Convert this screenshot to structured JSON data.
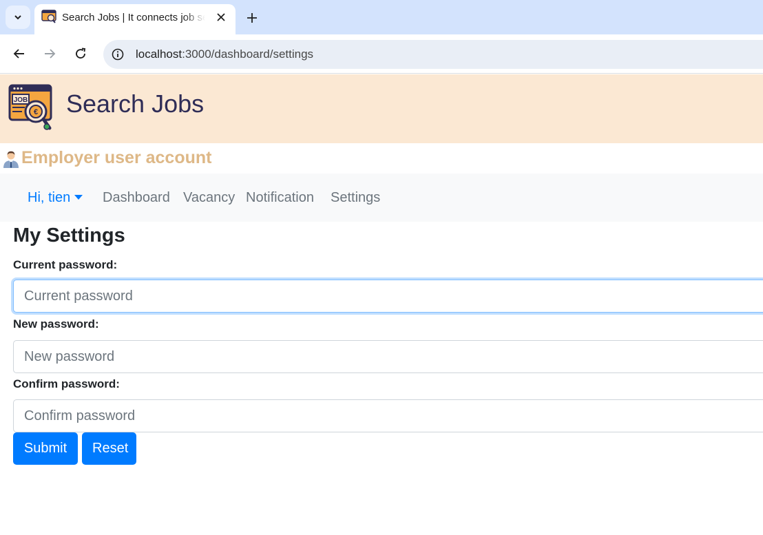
{
  "browser": {
    "tab_title": "Search Jobs | It connects job seekers and employers",
    "url_host": "localhost",
    "url_rest": ":3000/dashboard/settings",
    "icons": {
      "tab_search": "chevron-down-icon",
      "tab_close": "close-icon",
      "new_tab": "plus-icon",
      "back": "back-arrow-icon",
      "forward": "forward-arrow-icon",
      "reload": "reload-icon",
      "site_info": "info-icon"
    }
  },
  "header": {
    "brand": "Search Jobs",
    "logo": "job-search-logo-icon"
  },
  "account": {
    "label": "Employer user account",
    "icon": "businessman-icon",
    "color": "#deb887"
  },
  "navbar": {
    "user": "Hi, tien",
    "links": [
      "Dashboard",
      "Vacancy",
      "Notification",
      "Settings"
    ]
  },
  "form": {
    "title": "My Settings",
    "current_label": "Current password:",
    "current_placeholder": "Current password",
    "new_label": "New password:",
    "new_placeholder": "New password",
    "confirm_label": "Confirm password:",
    "confirm_placeholder": "Confirm password",
    "submit": "Submit",
    "reset": "Reset"
  },
  "colors": {
    "banner": "#fbe8d3",
    "primary": "#007bff",
    "brand_text": "#2f2d57"
  }
}
